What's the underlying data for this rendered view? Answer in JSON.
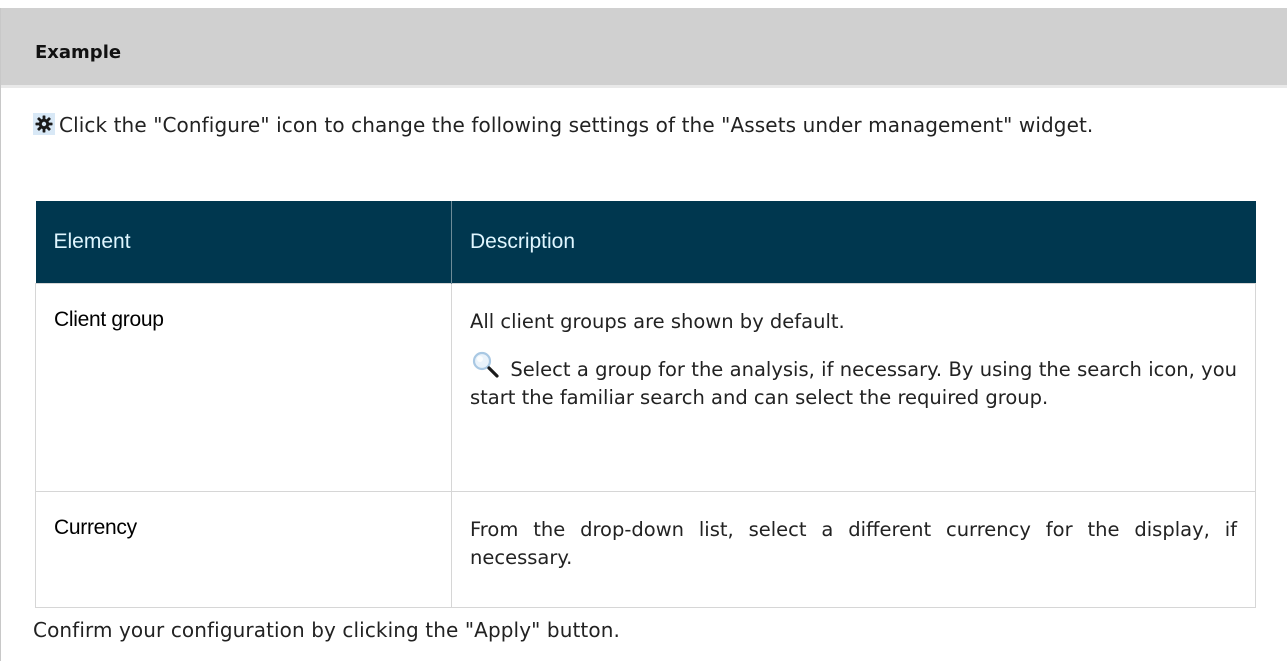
{
  "example": {
    "title": "Example",
    "intro_text": "Click the \"Configure\" icon to change the following settings of the \"Assets under management\" widget.",
    "table": {
      "headers": [
        "Element",
        "Description"
      ],
      "rows": [
        {
          "element": "Client group",
          "description_1": "All client groups are shown by default.",
          "description_2": "Select a group for the analysis, if necessary. By using the search icon, you start the familiar search and can select the required group."
        },
        {
          "element": "Currency",
          "description_1": "From the drop-down list, select a different currency for the display, if necessary."
        }
      ]
    },
    "footer_text": "Confirm your configuration by clicking the \"Apply\" button."
  },
  "icons": {
    "configure": "gear-icon",
    "search": "search-icon"
  },
  "colors": {
    "header_bg": "#d0d0d0",
    "table_header_bg": "#00374f",
    "table_header_text": "#dff6ff"
  }
}
